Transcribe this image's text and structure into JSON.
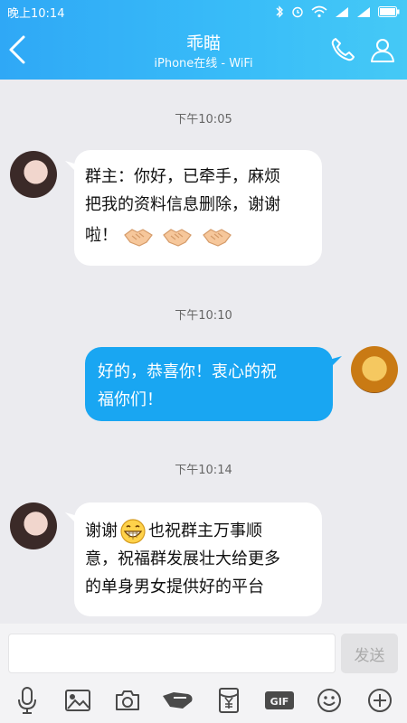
{
  "status": {
    "time": "晚上10:14",
    "icons": [
      "bluetooth-icon",
      "alarm-icon",
      "wifi-icon",
      "signal-icon",
      "signal-icon",
      "battery-icon"
    ]
  },
  "header": {
    "title": "乖瞄",
    "subtitle": "iPhone在线 - WiFi",
    "accent": "#2fa8f6"
  },
  "messages": [
    {
      "time": "下午10:05",
      "side": "left",
      "text_lines": [
        "群主：你好，已牵手，麻烦",
        "把我的资料信息删除，谢谢",
        "啦！"
      ],
      "emoji": [
        "handshake-icon",
        "handshake-icon",
        "handshake-icon"
      ]
    },
    {
      "time": "下午10:10",
      "side": "right",
      "text_lines": [
        "好的，恭喜你！衷心的祝",
        "福你们！"
      ]
    },
    {
      "time": "下午10:14",
      "side": "left",
      "text_prefix": "谢谢",
      "text_after_emoji": "也祝群主万事顺",
      "text_lines_rest": [
        "意，祝福群发展壮大给更多",
        "的单身男女提供好的平台"
      ],
      "emoji": [
        "grin-icon"
      ]
    }
  ],
  "input": {
    "value": "",
    "placeholder": ""
  },
  "send_label": "发送",
  "toolbar": [
    "mic-icon",
    "image-icon",
    "camera-icon",
    "hongbao-icon",
    "red-packet-yuan-icon",
    "gif-icon",
    "emoji-icon",
    "plus-icon"
  ],
  "colors": {
    "bubble_right": "#19a6f2",
    "bubble_left": "#ffffff",
    "background": "#ebebef"
  }
}
